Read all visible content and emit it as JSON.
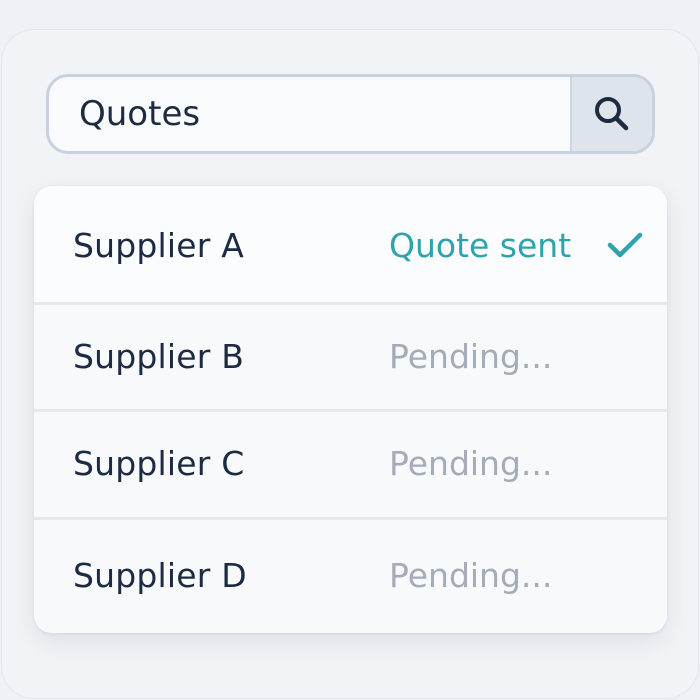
{
  "search": {
    "value": "Quotes",
    "button_icon": "search-icon"
  },
  "colors": {
    "accent": "#2fa3ad",
    "pending": "#a3acb8",
    "text": "#1c2b41"
  },
  "suppliers": [
    {
      "name": "Supplier A",
      "status": "Quote sent",
      "status_icon": "check-icon"
    },
    {
      "name": "Supplier B",
      "status": "Pending..."
    },
    {
      "name": "Supplier C",
      "status": "Pending..."
    },
    {
      "name": "Supplier D",
      "status": "Pending..."
    }
  ]
}
